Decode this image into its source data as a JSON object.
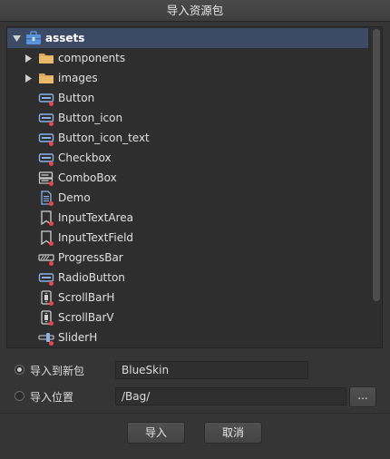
{
  "window": {
    "title": "导入资源包"
  },
  "tree": {
    "root": {
      "label": "assets",
      "icon": "package-icon"
    },
    "items": [
      {
        "label": "components",
        "icon": "folder-icon",
        "type": "folder"
      },
      {
        "label": "images",
        "icon": "folder-icon",
        "type": "folder"
      },
      {
        "label": "Button",
        "icon": "button-component-icon",
        "type": "component"
      },
      {
        "label": "Button_icon",
        "icon": "button-component-icon",
        "type": "component"
      },
      {
        "label": "Button_icon_text",
        "icon": "button-component-icon",
        "type": "component"
      },
      {
        "label": "Checkbox",
        "icon": "button-component-icon",
        "type": "component"
      },
      {
        "label": "ComboBox",
        "icon": "combobox-component-icon",
        "type": "component"
      },
      {
        "label": "Demo",
        "icon": "document-icon",
        "type": "document"
      },
      {
        "label": "InputTextArea",
        "icon": "label-component-icon",
        "type": "component"
      },
      {
        "label": "InputTextField",
        "icon": "label-component-icon",
        "type": "component"
      },
      {
        "label": "ProgressBar",
        "icon": "progressbar-component-icon",
        "type": "component"
      },
      {
        "label": "RadioButton",
        "icon": "button-component-icon",
        "type": "component"
      },
      {
        "label": "ScrollBarH",
        "icon": "scrollbar-component-icon",
        "type": "component"
      },
      {
        "label": "ScrollBarV",
        "icon": "scrollbar-component-icon",
        "type": "component"
      },
      {
        "label": "SliderH",
        "icon": "slider-component-icon",
        "type": "component"
      }
    ]
  },
  "options": {
    "new_package": {
      "label": "导入到新包",
      "value": "BlueSkin",
      "selected": true
    },
    "location": {
      "label": "导入位置",
      "value": "/Bag/",
      "selected": false,
      "browse_label": "..."
    }
  },
  "buttons": {
    "import": "导入",
    "cancel": "取消"
  },
  "colors": {
    "selection": "#3c4a66",
    "badge": "#e8464e",
    "icon_blue": "#8ab0e8"
  }
}
